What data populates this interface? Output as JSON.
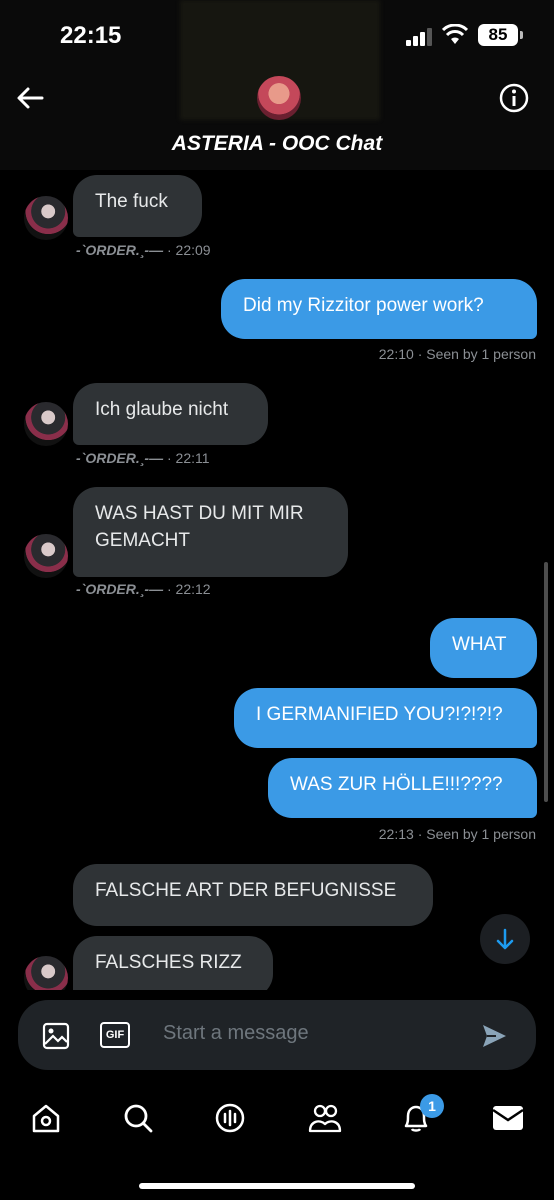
{
  "status_bar": {
    "time": "22:15",
    "battery": "85"
  },
  "header": {
    "title": "ASTERIA - OOC Chat"
  },
  "messages": [
    {
      "text": "The fuck",
      "sender_name": "-`ORDER.¸-—",
      "time": "· 22:09"
    },
    {
      "text": "Did my Rizzitor power work?",
      "meta": "22:10 · Seen by 1 person"
    },
    {
      "text": "Ich glaube nicht",
      "sender_name": "-`ORDER.¸-—",
      "time": "· 22:11"
    },
    {
      "text": "WAS HAST DU MIT MIR GEMACHT",
      "sender_name": "-`ORDER.¸-—",
      "time": "· 22:12"
    },
    {
      "text": "WHAT"
    },
    {
      "text": "I GERMANIFIED YOU?!?!?!?"
    },
    {
      "text": "WAS ZUR HÖLLE!!!????",
      "meta": "22:13 · Seen by 1 person"
    },
    {
      "text": "FALSCHE ART DER BEFUGNISSE"
    },
    {
      "text": "FALSCHES RIZZ"
    }
  ],
  "composer": {
    "placeholder": "Start a message",
    "gif_label": "GIF"
  },
  "tabbar": {
    "notifications_badge": "1"
  }
}
